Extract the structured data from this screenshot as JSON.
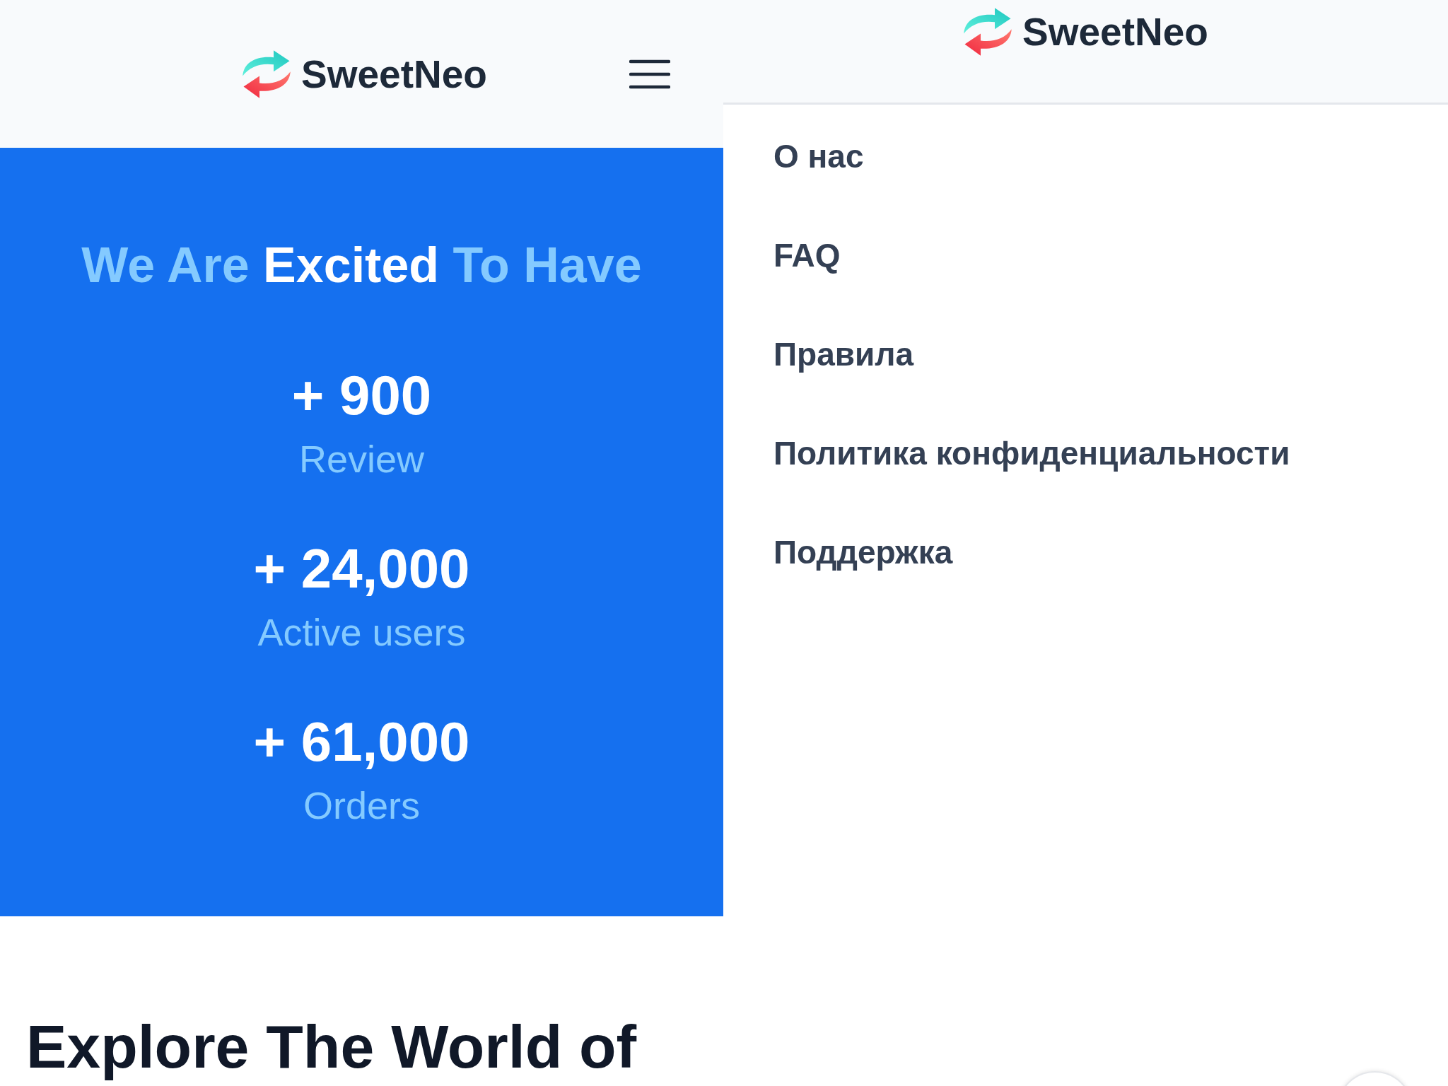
{
  "page": {
    "header": {
      "logo": "SweetNeo"
    },
    "hero": {
      "title_parts": [
        {
          "text": "We Are",
          "highlight": false
        },
        {
          "text": "Excited",
          "highlight": true
        },
        {
          "text": "To Have",
          "highlight": false
        }
      ],
      "stats": [
        {
          "value": "+ 900",
          "label": "Review"
        },
        {
          "value": "+ 24,000",
          "label": "Active users"
        },
        {
          "value": "+ 61,000",
          "label": "Orders"
        }
      ]
    },
    "next_section": {
      "title": "Explore The World of"
    }
  },
  "menu_drawer": {
    "logo": "SweetNeo",
    "items": [
      {
        "label": "О нас"
      },
      {
        "label": "FAQ"
      },
      {
        "label": "Правила"
      },
      {
        "label": "Политика конфиденциальности"
      },
      {
        "label": "Поддержка"
      }
    ]
  }
}
